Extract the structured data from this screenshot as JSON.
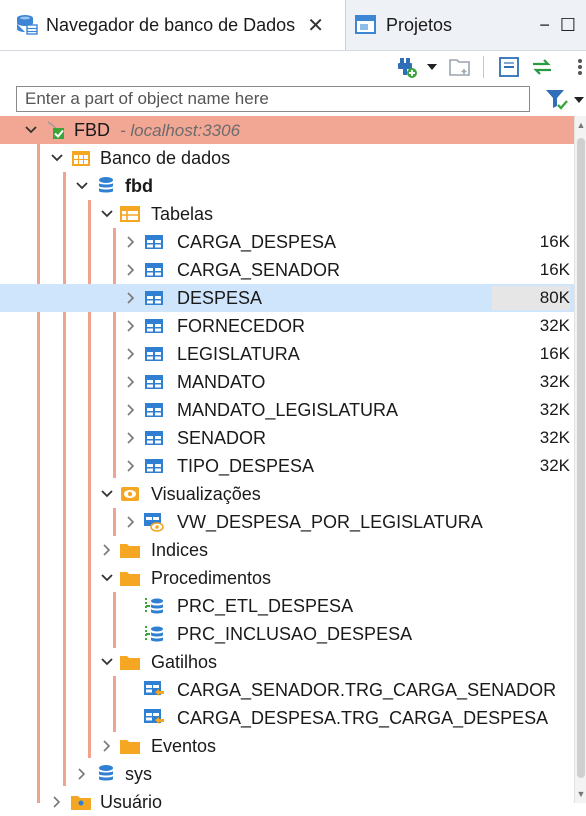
{
  "tabs": {
    "active_label": "Navegador de banco de Dados",
    "inactive_label": "Projetos",
    "close_symbol": "✕"
  },
  "window_buttons": {
    "minimize": "−",
    "maximize": "☐"
  },
  "toolbar": {
    "icons": [
      "new-connection-icon",
      "dropdown-arrow-icon",
      "new-folder-icon",
      "collapse-all-icon",
      "link-editor-icon",
      "view-menu-icon"
    ]
  },
  "filter": {
    "placeholder": "Enter a part of object name here",
    "value": ""
  },
  "tree": {
    "connection": {
      "name": "FBD",
      "host": "- localhost:3306"
    },
    "database_folder": "Banco de dados",
    "schema": "fbd",
    "tables_folder": "Tabelas",
    "tables": [
      {
        "name": "CARGA_DESPESA",
        "size": "16K"
      },
      {
        "name": "CARGA_SENADOR",
        "size": "16K"
      },
      {
        "name": "DESPESA",
        "size": "80K"
      },
      {
        "name": "FORNECEDOR",
        "size": "32K"
      },
      {
        "name": "LEGISLATURA",
        "size": "16K"
      },
      {
        "name": "MANDATO",
        "size": "32K"
      },
      {
        "name": "MANDATO_LEGISLATURA",
        "size": "32K"
      },
      {
        "name": "SENADOR",
        "size": "32K"
      },
      {
        "name": "TIPO_DESPESA",
        "size": "32K"
      }
    ],
    "views_folder": "Visualizações",
    "views": [
      "VW_DESPESA_POR_LEGISLATURA"
    ],
    "indexes_folder": "Indices",
    "procedures_folder": "Procedimentos",
    "procedures": [
      "PRC_ETL_DESPESA",
      "PRC_INCLUSAO_DESPESA"
    ],
    "triggers_folder": "Gatilhos",
    "triggers": [
      "CARGA_SENADOR.TRG_CARGA_SENADOR",
      "CARGA_DESPESA.TRG_CARGA_DESPESA"
    ],
    "events_folder": "Eventos",
    "sys_schema": "sys",
    "users_folder": "Usuário"
  },
  "colors": {
    "tree_line": "#f0a490",
    "connection_highlight": "#f2a694",
    "selection": "#cfe5fb",
    "folder": "#f5a623",
    "table_icon": "#2f7fd3"
  }
}
